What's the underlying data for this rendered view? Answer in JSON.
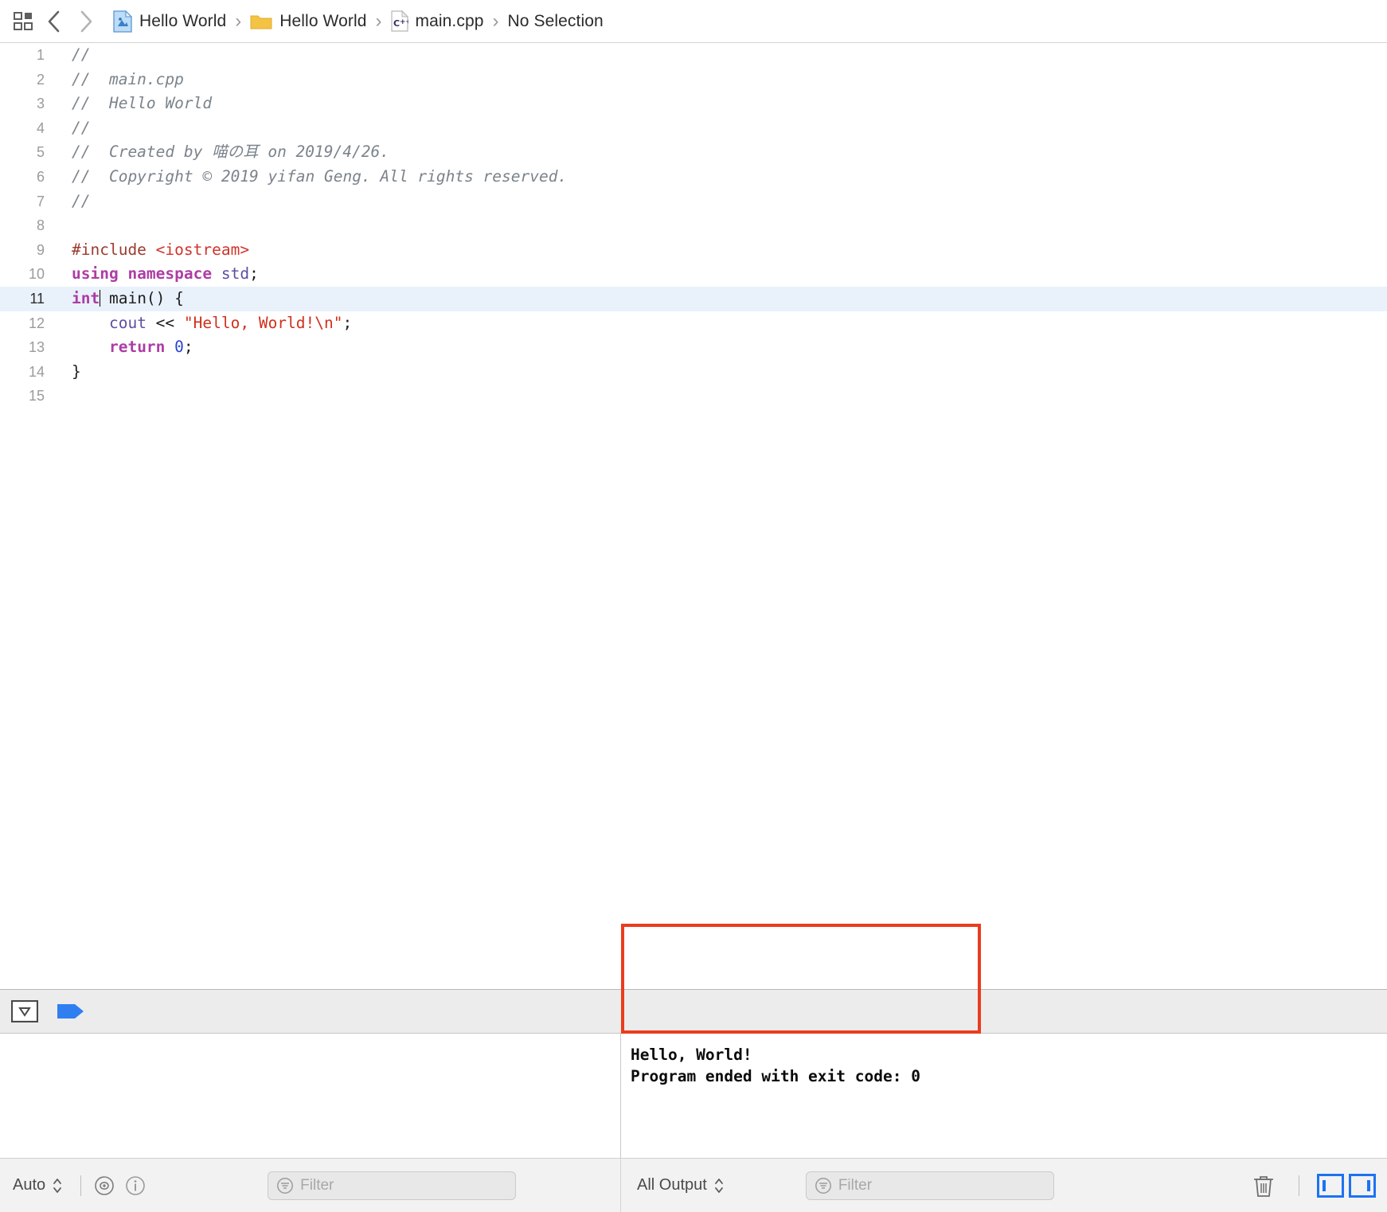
{
  "jumpbar": {
    "related_items_icon": "grid-related-items-icon",
    "back_label": "‹",
    "forward_label": "›",
    "separator": "›",
    "crumbs": [
      {
        "icon": "xcode-project-icon",
        "label": "Hello World"
      },
      {
        "icon": "folder-icon",
        "label": "Hello World"
      },
      {
        "icon": "cpp-file-icon",
        "label": "main.cpp"
      },
      {
        "icon": "",
        "label": "No Selection"
      }
    ]
  },
  "editor": {
    "selected_line": 11,
    "highlight_color": "#e9f1fb",
    "lines": [
      {
        "n": "1",
        "tokens": [
          {
            "t": "//",
            "c": "cmt"
          }
        ]
      },
      {
        "n": "2",
        "tokens": [
          {
            "t": "//  main.cpp",
            "c": "cmt"
          }
        ]
      },
      {
        "n": "3",
        "tokens": [
          {
            "t": "//  Hello World",
            "c": "cmt"
          }
        ]
      },
      {
        "n": "4",
        "tokens": [
          {
            "t": "//",
            "c": "cmt"
          }
        ]
      },
      {
        "n": "5",
        "tokens": [
          {
            "t": "//  Created by 喵の耳 on 2019/4/26.",
            "c": "cmt"
          }
        ]
      },
      {
        "n": "6",
        "tokens": [
          {
            "t": "//  Copyright © 2019 yifan Geng. All rights reserved.",
            "c": "cmt"
          }
        ]
      },
      {
        "n": "7",
        "tokens": [
          {
            "t": "//",
            "c": "cmt"
          }
        ]
      },
      {
        "n": "8",
        "tokens": []
      },
      {
        "n": "9",
        "tokens": [
          {
            "t": "#include ",
            "c": "pre"
          },
          {
            "t": "<iostream>",
            "c": "hdr"
          }
        ]
      },
      {
        "n": "10",
        "tokens": [
          {
            "t": "using namespace ",
            "c": "kw"
          },
          {
            "t": "std",
            "c": "vid"
          },
          {
            "t": ";",
            "c": "plain"
          }
        ]
      },
      {
        "n": "11",
        "tokens": [
          {
            "t": "int",
            "c": "kw"
          },
          {
            "t": "",
            "c": "caret"
          },
          {
            "t": " main() {",
            "c": "plain"
          }
        ]
      },
      {
        "n": "12",
        "tokens": [
          {
            "t": "    ",
            "c": "plain"
          },
          {
            "t": "cout",
            "c": "vid"
          },
          {
            "t": " << ",
            "c": "plain"
          },
          {
            "t": "\"Hello, World!\\n\"",
            "c": "str"
          },
          {
            "t": ";",
            "c": "plain"
          }
        ]
      },
      {
        "n": "13",
        "tokens": [
          {
            "t": "    ",
            "c": "plain"
          },
          {
            "t": "return",
            "c": "kw"
          },
          {
            "t": " ",
            "c": "plain"
          },
          {
            "t": "0",
            "c": "num"
          },
          {
            "t": ";",
            "c": "plain"
          }
        ]
      },
      {
        "n": "14",
        "tokens": [
          {
            "t": "}",
            "c": "plain"
          }
        ]
      },
      {
        "n": "15",
        "tokens": []
      }
    ]
  },
  "debugbar": {
    "toggle_debug_area_icon": "hide-debug-area-icon",
    "continue_icon": "continue-flag-icon"
  },
  "console": {
    "output": "Hello, World!\nProgram ended with exit code: 0",
    "annotation_color": "#ea3c1e"
  },
  "statusbar": {
    "left": {
      "scope_label": "Auto",
      "stepper_icon": "up-down-stepper-icon",
      "eye_icon": "eye-icon",
      "info_icon": "info-circle-icon",
      "filter_icon": "filter-funnel-icon",
      "filter_placeholder": "Filter"
    },
    "right": {
      "output_label": "All Output",
      "stepper_icon": "up-down-stepper-icon",
      "filter_icon": "filter-funnel-icon",
      "filter_placeholder": "Filter",
      "trash_icon": "trash-icon",
      "split_left_icon": "show-variables-pane-icon",
      "split_right_icon": "show-console-pane-icon",
      "accent_color": "#1d72f3"
    }
  }
}
